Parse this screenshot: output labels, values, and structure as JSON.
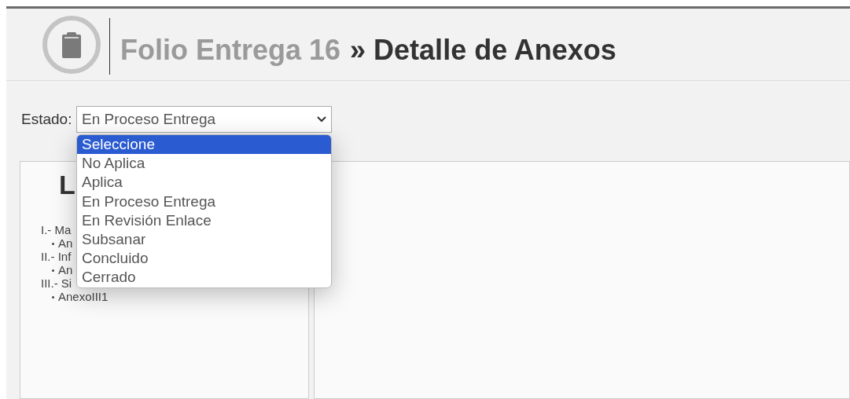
{
  "header": {
    "folio": "Folio Entrega 16",
    "separator": "»",
    "title": "Detalle de Anexos"
  },
  "estado": {
    "label": "Estado:",
    "value": "En Proceso Entrega",
    "expanded": true,
    "options": [
      {
        "label": "Seleccione",
        "highlighted": true
      },
      {
        "label": "No Aplica",
        "highlighted": false
      },
      {
        "label": "Aplica",
        "highlighted": false
      },
      {
        "label": "En Proceso Entrega",
        "highlighted": false
      },
      {
        "label": "En Revisión Enlace",
        "highlighted": false
      },
      {
        "label": "Subsanar",
        "highlighted": false
      },
      {
        "label": "Concluido",
        "highlighted": false
      },
      {
        "label": "Cerrado",
        "highlighted": false
      }
    ]
  },
  "left_panel": {
    "title": "L",
    "tree": [
      {
        "label": "I.- Ma",
        "children": [
          {
            "label": "An"
          }
        ]
      },
      {
        "label": "II.- Inf",
        "children": [
          {
            "label": "An"
          }
        ]
      },
      {
        "label": "III.- Si",
        "children": [
          {
            "label": "AnexoIII1"
          }
        ]
      }
    ]
  }
}
